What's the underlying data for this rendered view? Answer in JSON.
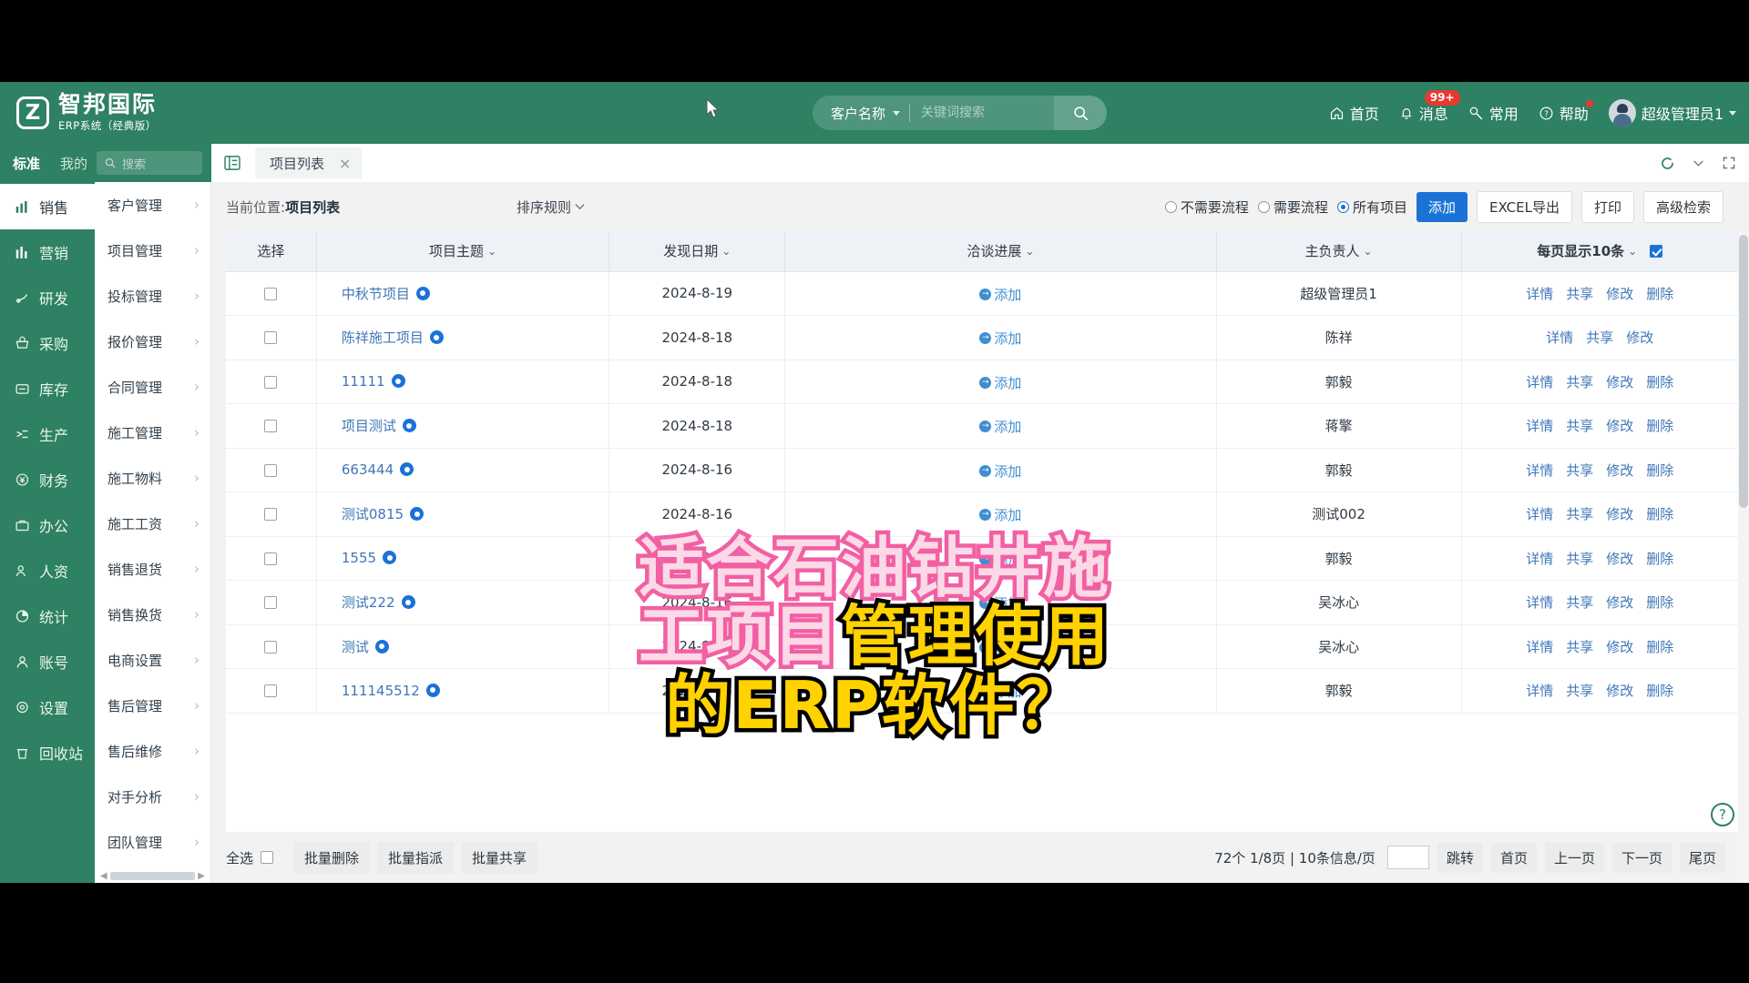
{
  "header": {
    "brand_initial": "Z",
    "brand_name": "智邦国际",
    "brand_sub": "ERP系统（经典版）",
    "search_category": "客户名称",
    "search_placeholder": "关键词搜索",
    "search_value": "",
    "search_icon": "search-icon",
    "nav": [
      {
        "label": "首页",
        "icon": "home-icon",
        "badge": ""
      },
      {
        "label": "消息",
        "icon": "bell-icon",
        "badge": "99+"
      },
      {
        "label": "常用",
        "icon": "wrench-icon",
        "badge": ""
      },
      {
        "label": "帮助",
        "icon": "question-circle-icon",
        "badge": "dot"
      }
    ],
    "user_name": "超级管理员1"
  },
  "tabstrip": {
    "mode_standard": "标准",
    "mode_mine": "我的",
    "search_placeholder": "搜索",
    "collapse_icon": "collapse-panel-icon",
    "tabs": [
      {
        "label": "项目列表",
        "close": "×"
      }
    ],
    "right_icons": [
      "refresh-icon",
      "chevron-down-icon",
      "fullscreen-icon"
    ]
  },
  "sidebar_primary": [
    {
      "label": "销售",
      "icon": "chart-bar-icon",
      "active": true
    },
    {
      "label": "营销",
      "icon": "bars-icon",
      "active": false
    },
    {
      "label": "研发",
      "icon": "flask-icon",
      "active": false
    },
    {
      "label": "采购",
      "icon": "basket-icon",
      "active": false
    },
    {
      "label": "库存",
      "icon": "box-icon",
      "active": false
    },
    {
      "label": "生产",
      "icon": "gear-tools-icon",
      "active": false
    },
    {
      "label": "财务",
      "icon": "yen-circle-icon",
      "active": false
    },
    {
      "label": "办公",
      "icon": "briefcase-icon",
      "active": false
    },
    {
      "label": "人资",
      "icon": "user-group-icon",
      "active": false
    },
    {
      "label": "统计",
      "icon": "pie-chart-icon",
      "active": false
    },
    {
      "label": "账号",
      "icon": "user-icon",
      "active": false
    },
    {
      "label": "设置",
      "icon": "gear-icon",
      "active": false
    },
    {
      "label": "回收站",
      "icon": "trash-icon",
      "active": false
    }
  ],
  "sidebar_secondary": [
    {
      "label": "客户管理"
    },
    {
      "label": "项目管理"
    },
    {
      "label": "投标管理"
    },
    {
      "label": "报价管理"
    },
    {
      "label": "合同管理"
    },
    {
      "label": "施工管理"
    },
    {
      "label": "施工物料"
    },
    {
      "label": "施工工资"
    },
    {
      "label": "销售退货"
    },
    {
      "label": "销售换货"
    },
    {
      "label": "电商设置"
    },
    {
      "label": "售后管理"
    },
    {
      "label": "售后维修"
    },
    {
      "label": "对手分析"
    },
    {
      "label": "团队管理"
    }
  ],
  "toolbar": {
    "breadcrumb_prefix": "当前位置:",
    "breadcrumb_current": "项目列表",
    "sort_rule": "排序规则",
    "radios": [
      {
        "label": "不需要流程",
        "checked": false
      },
      {
        "label": "需要流程",
        "checked": false
      },
      {
        "label": "所有项目",
        "checked": true
      }
    ],
    "add_label": "添加",
    "excel_label": "EXCEL导出",
    "print_label": "打印",
    "advanced_label": "高级检索",
    "accent_color": "#1b72d6"
  },
  "table": {
    "columns": [
      "选择",
      "项目主题",
      "发现日期",
      "洽谈进展",
      "主负责人",
      "每页显示10条"
    ],
    "rows": [
      {
        "subject": "中秋节项目",
        "date": "2024-8-19",
        "progress": "添加",
        "owner": "超级管理员1",
        "ops": [
          "详情",
          "共享",
          "修改",
          "删除"
        ]
      },
      {
        "subject": "陈祥施工项目",
        "date": "2024-8-18",
        "progress": "添加",
        "owner": "陈祥",
        "ops": [
          "详情",
          "共享",
          "修改"
        ]
      },
      {
        "subject": "11111",
        "date": "2024-8-18",
        "progress": "添加",
        "owner": "郭毅",
        "ops": [
          "详情",
          "共享",
          "修改",
          "删除"
        ]
      },
      {
        "subject": "项目测试",
        "date": "2024-8-18",
        "progress": "添加",
        "owner": "蒋擎",
        "ops": [
          "详情",
          "共享",
          "修改",
          "删除"
        ]
      },
      {
        "subject": "663444",
        "date": "2024-8-16",
        "progress": "添加",
        "owner": "郭毅",
        "ops": [
          "详情",
          "共享",
          "修改",
          "删除"
        ]
      },
      {
        "subject": "测试0815",
        "date": "2024-8-16",
        "progress": "添加",
        "owner": "测试002",
        "ops": [
          "详情",
          "共享",
          "修改",
          "删除"
        ]
      },
      {
        "subject": "1555",
        "date": "2024-8-16",
        "progress": "添加",
        "owner": "郭毅",
        "ops": [
          "详情",
          "共享",
          "修改",
          "删除"
        ]
      },
      {
        "subject": "测试222",
        "date": "2024-8-16",
        "progress": "添加",
        "owner": "吴冰心",
        "ops": [
          "详情",
          "共享",
          "修改",
          "删除"
        ]
      },
      {
        "subject": "测试",
        "date": "2024-8-16",
        "progress": "添加",
        "owner": "吴冰心",
        "ops": [
          "详情",
          "共享",
          "修改",
          "删除"
        ]
      },
      {
        "subject": "111145512",
        "date": "2024-8-15",
        "progress": "添加",
        "owner": "郭毅",
        "ops": [
          "详情",
          "共享",
          "修改",
          "删除"
        ]
      }
    ]
  },
  "footer": {
    "select_all": "全选",
    "batch_delete": "批量删除",
    "batch_assign": "批量指派",
    "batch_share": "批量共享",
    "page_info": "72个 1/8页 |  10条信息/页",
    "jump_value": "",
    "jump": "跳转",
    "first": "首页",
    "prev": "上一页",
    "next": "下一页",
    "last": "尾页",
    "help_icon": "question-mark-icon"
  },
  "overlay_caption": {
    "line1": "适合石油钻井施",
    "line2_pink": "工项目",
    "line2_yellow": "管理使用",
    "line3": "的ERP软件？",
    "pink": "#f25fa3",
    "yellow": "#ffd200"
  }
}
